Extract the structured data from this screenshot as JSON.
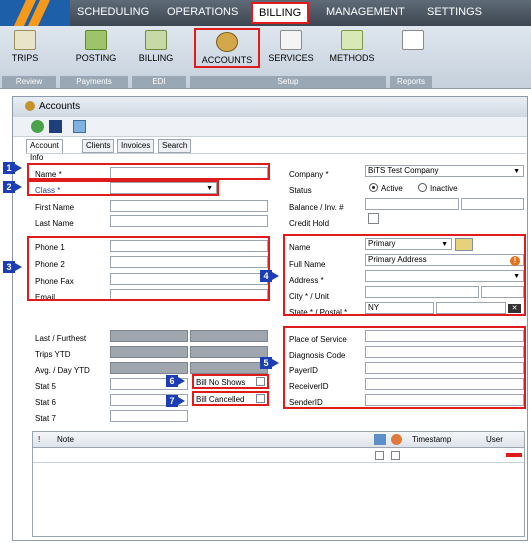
{
  "nav": {
    "items": [
      "SCHEDULING",
      "OPERATIONS",
      "BILLING",
      "MANAGEMENT",
      "SETTINGS"
    ]
  },
  "ribbon": {
    "buttons": [
      "TRIPS",
      "POSTING",
      "BILLING",
      "ACCOUNTS",
      "SERVICES",
      "METHODS"
    ],
    "groups": [
      "Review",
      "Payments",
      "EDI",
      "Setup",
      "Reports"
    ]
  },
  "window": {
    "title": "Accounts"
  },
  "tabs": [
    "Account Info",
    "Clients",
    "Invoices",
    "Search"
  ],
  "left_form": {
    "name_label": "Name *",
    "class_label": "Class *",
    "first_name_label": "First Name",
    "last_name_label": "Last Name",
    "phone1_label": "Phone 1",
    "phone2_label": "Phone 2",
    "phone_fax_label": "Phone Fax",
    "email_label": "Email",
    "last_furthest_label": "Last / Furthest",
    "trips_ytd_label": "Trips YTD",
    "avg_day_ytd_label": "Avg. / Day YTD",
    "stat5_label": "Stat 5",
    "stat6_label": "Stat 6",
    "stat7_label": "Stat 7",
    "bill_no_shows_label": "Bill No Shows",
    "bill_cancelled_label": "Bill Cancelled"
  },
  "right_form": {
    "company_label": "Company *",
    "company_value": "BiTS Test Company",
    "status_label": "Status",
    "status_active": "Active",
    "status_inactive": "Inactive",
    "balance_label": "Balance / Inv. #",
    "credit_hold_label": "Credit Hold",
    "name_label": "Name",
    "name_value": "Primary",
    "full_name_label": "Full Name",
    "full_name_value": "Primary Address",
    "address_label": "Address *",
    "city_label": "City * / Unit",
    "state_label": "State * / Postal *",
    "state_value": "NY",
    "place_of_service_label": "Place of Service",
    "diagnosis_code_label": "Diagnosis Code",
    "payer_id_label": "PayerID",
    "receiver_id_label": "ReceiverID",
    "sender_id_label": "SenderID"
  },
  "notes": {
    "col_bang": "!",
    "col_note": "Note",
    "col_timestamp": "Timestamp",
    "col_user": "User"
  },
  "markers": [
    "1",
    "2",
    "3",
    "4",
    "5",
    "6",
    "7"
  ],
  "colors": {
    "highlight": "#e01b1b",
    "marker": "#1b3db5",
    "nav": "#4a5561"
  }
}
